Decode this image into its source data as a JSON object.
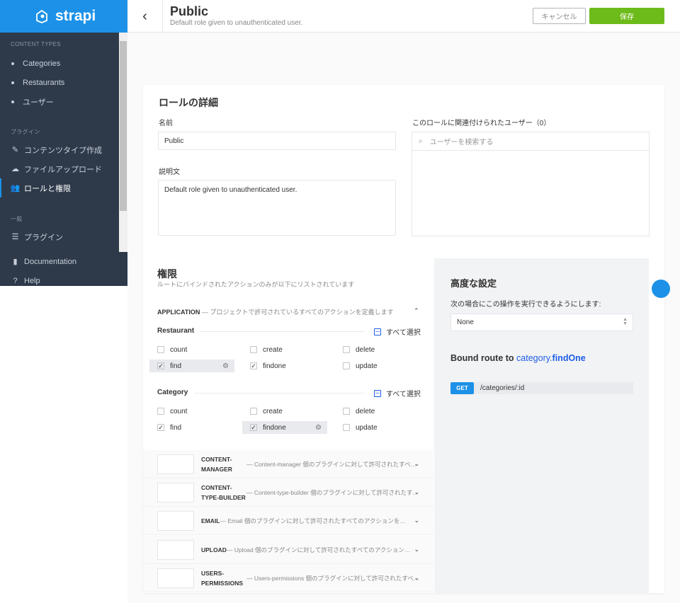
{
  "sidebar": {
    "logo": "strapi",
    "sections": [
      {
        "title": "CONTENT TYPES",
        "items": [
          "Categories",
          "Restaurants",
          "ユーザー"
        ]
      },
      {
        "title": "プラグイン",
        "items": [
          "コンテンツタイプ作成",
          "ファイルアップロード",
          "ロールと権限"
        ]
      },
      {
        "title": "一般",
        "items": [
          "プラグイン"
        ]
      }
    ],
    "footer_items": [
      "Documentation",
      "Help"
    ]
  },
  "header": {
    "title": "Public",
    "subtitle": "Default role given to unauthenticated user.",
    "cancel_label": "キャンセル",
    "save_label": "保存"
  },
  "role_details": {
    "heading": "ロールの詳細",
    "name_label": "名前",
    "name_value": "Public",
    "description_label": "説明文",
    "description_value": "Default role given to unauthenticated user.",
    "users_label": "このロールに関連付けられたユーザー（0）",
    "users_search_placeholder": "ユーザーを検索する"
  },
  "permissions": {
    "heading": "権限",
    "subtitle": "ルートにバインドされたアクションのみが以下にリストされています",
    "application_label": "APPLICATION",
    "application_desc": " — プロジェクトで許可されているすべてのアクションを定義します",
    "select_all": "すべて選択",
    "groups": [
      {
        "name": "Restaurant",
        "actions": [
          {
            "label": "count",
            "checked": false
          },
          {
            "label": "create",
            "checked": false
          },
          {
            "label": "delete",
            "checked": false
          },
          {
            "label": "find",
            "checked": true
          },
          {
            "label": "findone",
            "checked": true
          },
          {
            "label": "update",
            "checked": false
          }
        ]
      },
      {
        "name": "Category",
        "actions": [
          {
            "label": "count",
            "checked": false
          },
          {
            "label": "create",
            "checked": false
          },
          {
            "label": "delete",
            "checked": false
          },
          {
            "label": "find",
            "checked": true
          },
          {
            "label": "findone",
            "checked": true
          },
          {
            "label": "update",
            "checked": false
          }
        ]
      }
    ],
    "plugins": [
      {
        "name": "CONTENT-MANAGER",
        "desc": " — Content-manager 個のプラグインに対して許可されたすべてのアクションを定義します"
      },
      {
        "name": "CONTENT-TYPE-BUILDER",
        "desc": " — Content-type-builder 個のプラグインに対して許可されたすべてのアクションを定義します"
      },
      {
        "name": "EMAIL",
        "desc": " — Email 個のプラグインに対して許可されたすべてのアクションを定義します"
      },
      {
        "name": "UPLOAD",
        "desc": " — Upload 個のプラグインに対して許可されたすべてのアクションを定義します"
      },
      {
        "name": "USERS-PERMISSIONS",
        "desc": " — Users-permissions 個のプラグインに対して許可されたすべてのアクションを定義します"
      }
    ]
  },
  "advanced": {
    "heading": "高度な設定",
    "policy_label": "次の場合にこの操作を実行できるようにします:",
    "policy_value": "None",
    "bound_prefix": "Bound route to ",
    "bound_controller": "category",
    "bound_dot": ".",
    "bound_action": "findOne",
    "route_method": "GET",
    "route_path": "/categories/:id"
  },
  "colors": {
    "brand": "#1c91e7",
    "save": "#6dbb1a",
    "sidebar": "#2e3a4a"
  }
}
